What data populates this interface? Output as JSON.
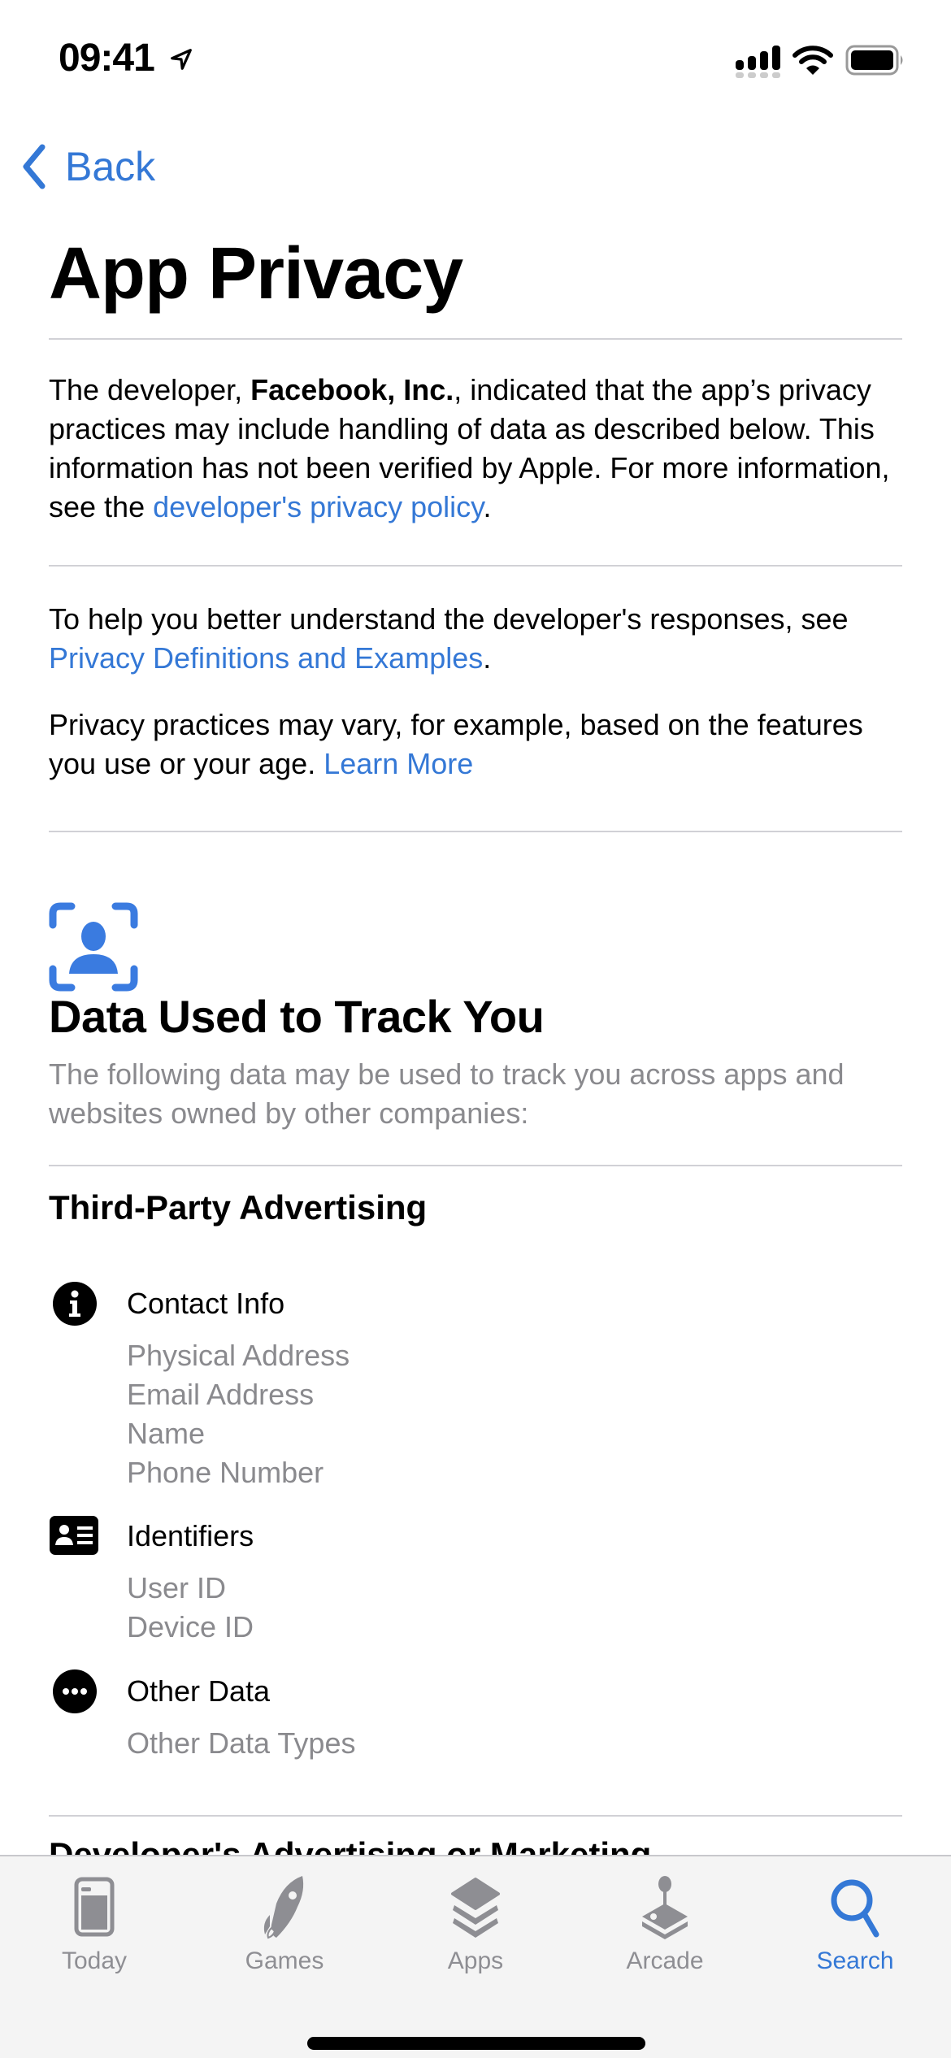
{
  "status_bar": {
    "time": "09:41",
    "icons": [
      "location-arrow-icon",
      "cellular-signal-icon",
      "wifi-icon",
      "battery-icon"
    ]
  },
  "nav": {
    "back_label": "Back",
    "back_icon": "chevron-left-icon"
  },
  "page_title": "App Privacy",
  "intro": {
    "prefix": "The developer, ",
    "developer_name": "Facebook, Inc.",
    "middle": ", indicated that the app’s privacy practices may include handling of data as described below. This information has not been verified by Apple. For more information, see the ",
    "link": "developer's privacy policy",
    "suffix": "."
  },
  "definitions": {
    "prefix": "To help you better understand the developer's responses, see ",
    "link": "Privacy Definitions and Examples",
    "suffix": "."
  },
  "practices": {
    "text": "Privacy practices may vary, for example, based on the features you use or your age. ",
    "link": "Learn More"
  },
  "tracking_section": {
    "icon": "person-viewfinder-icon",
    "title": "Data Used to Track You",
    "subtitle": "The following data may be used to track you across apps and websites owned by other companies:",
    "purpose": "Third-Party Advertising",
    "categories": [
      {
        "icon": "info-circle-icon",
        "label": "Contact Info",
        "items": [
          "Physical Address",
          "Email Address",
          "Name",
          "Phone Number"
        ]
      },
      {
        "icon": "person-id-card-icon",
        "label": "Identifiers",
        "items": [
          "User ID",
          "Device ID"
        ]
      },
      {
        "icon": "ellipsis-circle-icon",
        "label": "Other Data",
        "items": [
          "Other Data Types"
        ]
      }
    ],
    "next_purpose_partial": "Developer's Advertising or Marketing"
  },
  "tab_bar": {
    "tabs": [
      {
        "label": "Today",
        "icon": "today-icon",
        "active": false
      },
      {
        "label": "Games",
        "icon": "rocket-icon",
        "active": false
      },
      {
        "label": "Apps",
        "icon": "layers-stack-icon",
        "active": false
      },
      {
        "label": "Arcade",
        "icon": "joystick-icon",
        "active": false
      },
      {
        "label": "Search",
        "icon": "search-icon",
        "active": true
      }
    ]
  },
  "colors": {
    "accent": "#3478d6",
    "secondary_text": "#8a8a8e",
    "tab_inactive": "#8e8e93",
    "divider": "#d1d1d6",
    "tab_bar_bg": "#f4f4f4"
  }
}
